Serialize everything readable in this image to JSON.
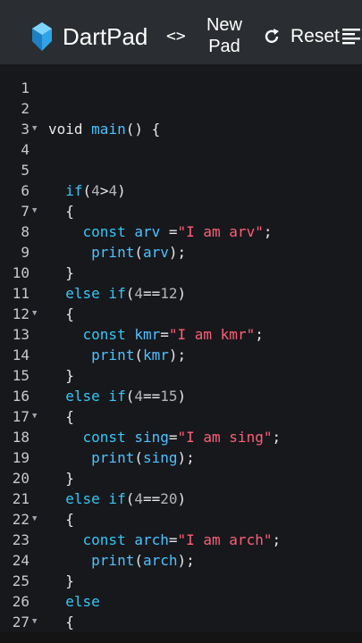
{
  "app": {
    "brand": "DartPad",
    "code_toggle": "<>",
    "new_pad_line1": "New",
    "new_pad_line2": "Pad",
    "reset_label": "Reset",
    "icons": [
      "dart-logo-icon",
      "code-icon",
      "refresh-icon",
      "menu-icon"
    ],
    "colors": {
      "appbar": "#2a2d31",
      "editor_bg": "#17181c",
      "keyword": "#38c6f4",
      "string": "#ff5f77"
    }
  },
  "editor": {
    "lines": [
      {
        "n": "1",
        "fold": false,
        "tokens": []
      },
      {
        "n": "2",
        "fold": false,
        "tokens": []
      },
      {
        "n": "3",
        "fold": true,
        "tokens": [
          {
            "t": "void ",
            "c": "punc"
          },
          {
            "t": "main",
            "c": "fn"
          },
          {
            "t": "() {",
            "c": "punc"
          }
        ]
      },
      {
        "n": "4",
        "fold": false,
        "tokens": []
      },
      {
        "n": "5",
        "fold": false,
        "tokens": []
      },
      {
        "n": "6",
        "fold": false,
        "tokens": [
          {
            "t": "  if",
            "c": "kw"
          },
          {
            "t": "(",
            "c": "punc"
          },
          {
            "t": "4",
            "c": "num"
          },
          {
            "t": ">",
            "c": "punc"
          },
          {
            "t": "4",
            "c": "num"
          },
          {
            "t": ")",
            "c": "punc"
          }
        ]
      },
      {
        "n": "7",
        "fold": true,
        "tokens": [
          {
            "t": "  {",
            "c": "punc"
          }
        ]
      },
      {
        "n": "8",
        "fold": false,
        "tokens": [
          {
            "t": "    const ",
            "c": "kw"
          },
          {
            "t": "arv ",
            "c": "fn"
          },
          {
            "t": "=",
            "c": "punc"
          },
          {
            "t": "\"I am arv\"",
            "c": "str"
          },
          {
            "t": ";",
            "c": "punc"
          }
        ]
      },
      {
        "n": "9",
        "fold": false,
        "tokens": [
          {
            "t": "     print",
            "c": "fn"
          },
          {
            "t": "(",
            "c": "punc"
          },
          {
            "t": "arv",
            "c": "fn"
          },
          {
            "t": ");",
            "c": "punc"
          }
        ]
      },
      {
        "n": "10",
        "fold": false,
        "tokens": [
          {
            "t": "  }",
            "c": "punc"
          }
        ]
      },
      {
        "n": "11",
        "fold": false,
        "tokens": [
          {
            "t": "  else if",
            "c": "kw"
          },
          {
            "t": "(",
            "c": "punc"
          },
          {
            "t": "4",
            "c": "num"
          },
          {
            "t": "==",
            "c": "punc"
          },
          {
            "t": "12",
            "c": "num"
          },
          {
            "t": ")",
            "c": "punc"
          }
        ]
      },
      {
        "n": "12",
        "fold": true,
        "tokens": [
          {
            "t": "  {",
            "c": "punc"
          }
        ]
      },
      {
        "n": "13",
        "fold": false,
        "tokens": [
          {
            "t": "    const ",
            "c": "kw"
          },
          {
            "t": "kmr",
            "c": "fn"
          },
          {
            "t": "=",
            "c": "punc"
          },
          {
            "t": "\"I am kmr\"",
            "c": "str"
          },
          {
            "t": ";",
            "c": "punc"
          }
        ]
      },
      {
        "n": "14",
        "fold": false,
        "tokens": [
          {
            "t": "     print",
            "c": "fn"
          },
          {
            "t": "(",
            "c": "punc"
          },
          {
            "t": "kmr",
            "c": "fn"
          },
          {
            "t": ");",
            "c": "punc"
          }
        ]
      },
      {
        "n": "15",
        "fold": false,
        "tokens": [
          {
            "t": "  }",
            "c": "punc"
          }
        ]
      },
      {
        "n": "16",
        "fold": false,
        "tokens": [
          {
            "t": "  else if",
            "c": "kw"
          },
          {
            "t": "(",
            "c": "punc"
          },
          {
            "t": "4",
            "c": "num"
          },
          {
            "t": "==",
            "c": "punc"
          },
          {
            "t": "15",
            "c": "num"
          },
          {
            "t": ")",
            "c": "punc"
          }
        ]
      },
      {
        "n": "17",
        "fold": true,
        "tokens": [
          {
            "t": "  {",
            "c": "punc"
          }
        ]
      },
      {
        "n": "18",
        "fold": false,
        "tokens": [
          {
            "t": "    const ",
            "c": "kw"
          },
          {
            "t": "sing",
            "c": "fn"
          },
          {
            "t": "=",
            "c": "punc"
          },
          {
            "t": "\"I am sing\"",
            "c": "str"
          },
          {
            "t": ";",
            "c": "punc"
          }
        ]
      },
      {
        "n": "19",
        "fold": false,
        "tokens": [
          {
            "t": "     print",
            "c": "fn"
          },
          {
            "t": "(",
            "c": "punc"
          },
          {
            "t": "sing",
            "c": "fn"
          },
          {
            "t": ");",
            "c": "punc"
          }
        ]
      },
      {
        "n": "20",
        "fold": false,
        "tokens": [
          {
            "t": "  }",
            "c": "punc"
          }
        ]
      },
      {
        "n": "21",
        "fold": false,
        "tokens": [
          {
            "t": "  else if",
            "c": "kw"
          },
          {
            "t": "(",
            "c": "punc"
          },
          {
            "t": "4",
            "c": "num"
          },
          {
            "t": "==",
            "c": "punc"
          },
          {
            "t": "20",
            "c": "num"
          },
          {
            "t": ")",
            "c": "punc"
          }
        ]
      },
      {
        "n": "22",
        "fold": true,
        "tokens": [
          {
            "t": "  {",
            "c": "punc"
          }
        ]
      },
      {
        "n": "23",
        "fold": false,
        "tokens": [
          {
            "t": "    const ",
            "c": "kw"
          },
          {
            "t": "arch",
            "c": "fn"
          },
          {
            "t": "=",
            "c": "punc"
          },
          {
            "t": "\"I am arch\"",
            "c": "str"
          },
          {
            "t": ";",
            "c": "punc"
          }
        ]
      },
      {
        "n": "24",
        "fold": false,
        "tokens": [
          {
            "t": "     print",
            "c": "fn"
          },
          {
            "t": "(",
            "c": "punc"
          },
          {
            "t": "arch",
            "c": "fn"
          },
          {
            "t": ");",
            "c": "punc"
          }
        ]
      },
      {
        "n": "25",
        "fold": false,
        "tokens": [
          {
            "t": "  }",
            "c": "punc"
          }
        ]
      },
      {
        "n": "26",
        "fold": false,
        "tokens": [
          {
            "t": "  else",
            "c": "kw"
          }
        ]
      },
      {
        "n": "27",
        "fold": true,
        "tokens": [
          {
            "t": "  {",
            "c": "punc"
          }
        ]
      }
    ]
  }
}
